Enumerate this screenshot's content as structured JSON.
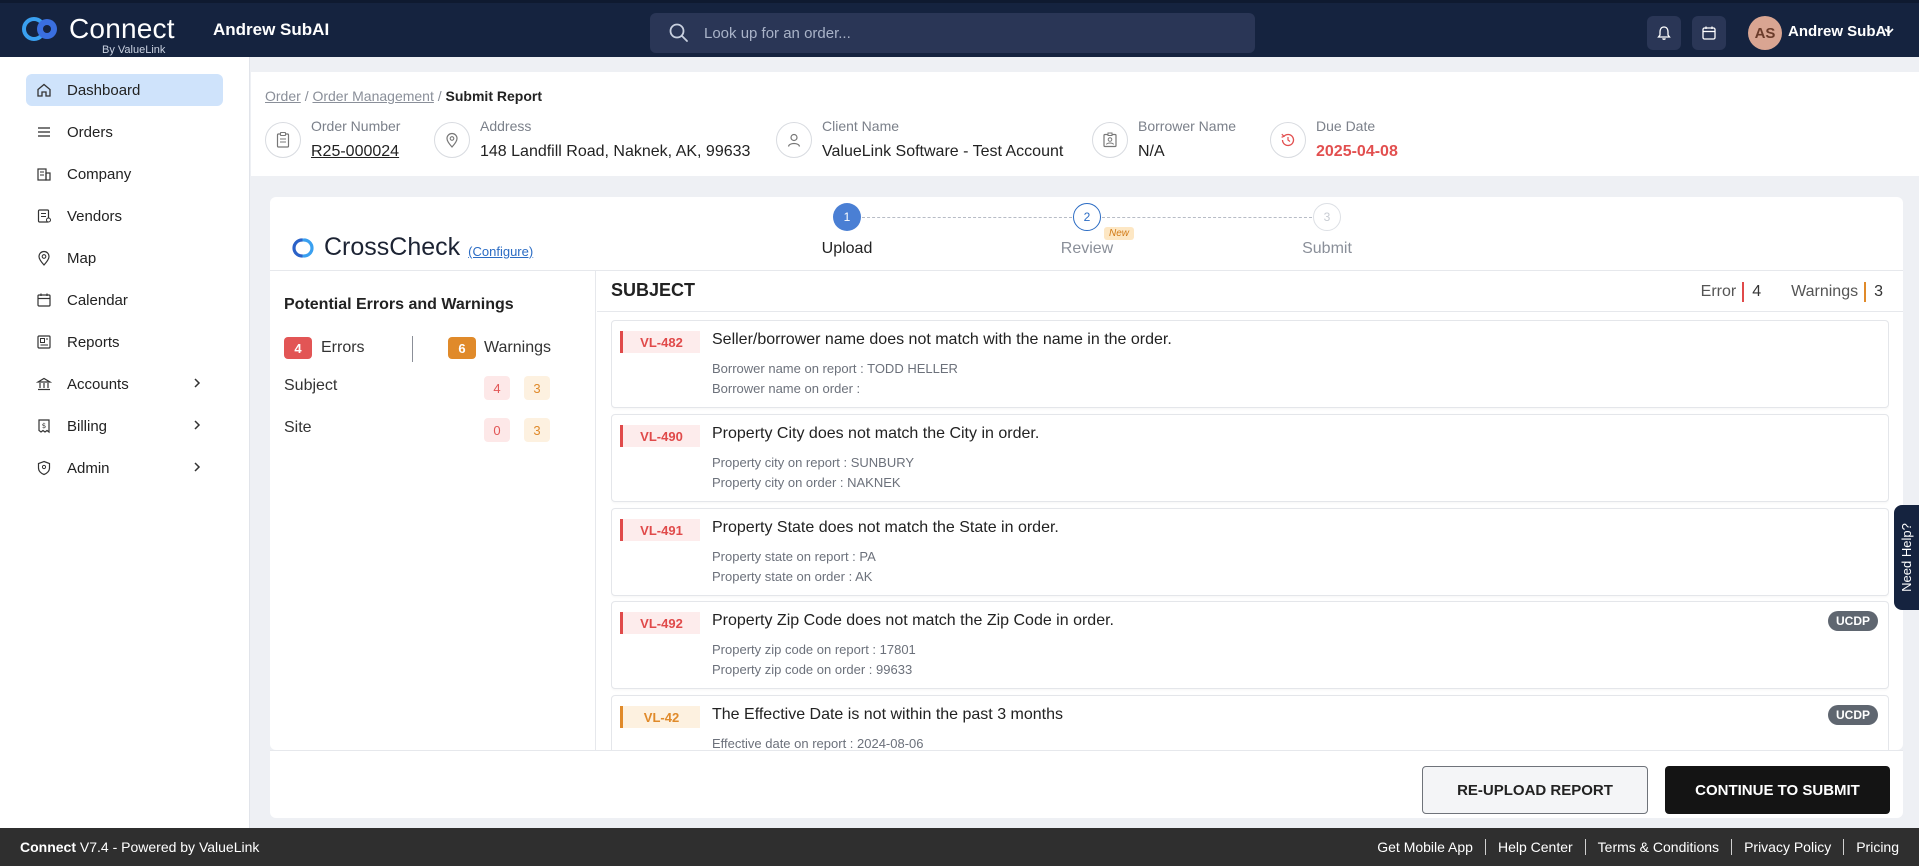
{
  "app": {
    "brand": "Connect",
    "brand_sub": "By ValueLink",
    "workspace_user": "Andrew SubAI"
  },
  "search": {
    "placeholder": "Look up for an order..."
  },
  "user": {
    "initials": "AS",
    "name": "Andrew SubAI"
  },
  "sidebar": {
    "items": [
      {
        "label": "Dashboard",
        "icon": "home-icon",
        "active": true
      },
      {
        "label": "Orders",
        "icon": "list-icon"
      },
      {
        "label": "Company",
        "icon": "building-icon"
      },
      {
        "label": "Vendors",
        "icon": "vendor-icon"
      },
      {
        "label": "Map",
        "icon": "map-pin-icon"
      },
      {
        "label": "Calendar",
        "icon": "calendar-icon"
      },
      {
        "label": "Reports",
        "icon": "report-icon"
      },
      {
        "label": "Accounts",
        "icon": "bank-icon",
        "expandable": true
      },
      {
        "label": "Billing",
        "icon": "receipt-icon",
        "expandable": true
      },
      {
        "label": "Admin",
        "icon": "shield-icon",
        "expandable": true
      }
    ]
  },
  "breadcrumb": {
    "order": "Order",
    "management": "Order Management",
    "current": "Submit Report",
    "sep": "/"
  },
  "order_info": {
    "order_number_label": "Order Number",
    "order_number": "R25-000024",
    "address_label": "Address",
    "address": "148 Landfill Road, Naknek, AK, 99633",
    "client_label": "Client Name",
    "client": "ValueLink Software - Test Account",
    "borrower_label": "Borrower Name",
    "borrower": "N/A",
    "due_label": "Due Date",
    "due": "2025-04-08"
  },
  "crosscheck": {
    "name": "CrossCheck",
    "configure": "(Configure)"
  },
  "steps": [
    {
      "num": "1",
      "label": "Upload",
      "state": "active"
    },
    {
      "num": "2",
      "label": "Review",
      "state": "pending",
      "badge": "New"
    },
    {
      "num": "3",
      "label": "Submit",
      "state": "disabled"
    }
  ],
  "summary": {
    "title": "Potential Errors and Warnings",
    "errors_count": "4",
    "errors_label": "Errors",
    "warnings_count": "6",
    "warnings_label": "Warnings",
    "rows": [
      {
        "label": "Subject",
        "errors": "4",
        "warnings": "3"
      },
      {
        "label": "Site",
        "errors": "0",
        "warnings": "3"
      }
    ]
  },
  "section": {
    "title": "SUBJECT",
    "error_label": "Error",
    "error_count": "4",
    "warning_label": "Warnings",
    "warning_count": "3"
  },
  "issues": [
    {
      "code": "VL-482",
      "type": "error",
      "message": "Seller/borrower name does not match with the name in the order.",
      "detail1": "Borrower name on report : TODD HELLER",
      "detail2": "Borrower name on order :",
      "tag": ""
    },
    {
      "code": "VL-490",
      "type": "error",
      "message": "Property City does not match the City in order.",
      "detail1": "Property city on report : SUNBURY",
      "detail2": "Property city on order : NAKNEK",
      "tag": ""
    },
    {
      "code": "VL-491",
      "type": "error",
      "message": "Property State does not match the State in order.",
      "detail1": "Property state on report : PA",
      "detail2": "Property state on order : AK",
      "tag": ""
    },
    {
      "code": "VL-492",
      "type": "error",
      "message": "Property Zip Code does not match the Zip Code in order.",
      "detail1": "Property zip code on report : 17801",
      "detail2": "Property zip code on order : 99633",
      "tag": "UCDP"
    },
    {
      "code": "VL-42",
      "type": "warning",
      "message": "The Effective Date is not within the past 3 months",
      "detail1": "Effective date on report : 2024-08-06",
      "detail2": "",
      "tag": "UCDP"
    }
  ],
  "actions": {
    "reupload": "RE-UPLOAD REPORT",
    "continue": "CONTINUE TO SUBMIT"
  },
  "help": {
    "label": "Need Help?"
  },
  "footer": {
    "brand": "Connect",
    "version": " V7.4 - Powered by ValueLink",
    "links": [
      "Get Mobile App",
      "Help Center",
      "Terms & Conditions",
      "Privacy Policy",
      "Pricing"
    ]
  },
  "colors": {
    "navy": "#15233f",
    "error": "#e04a4a",
    "warning": "#e08a2a",
    "step_active": "#4a7fd4"
  }
}
